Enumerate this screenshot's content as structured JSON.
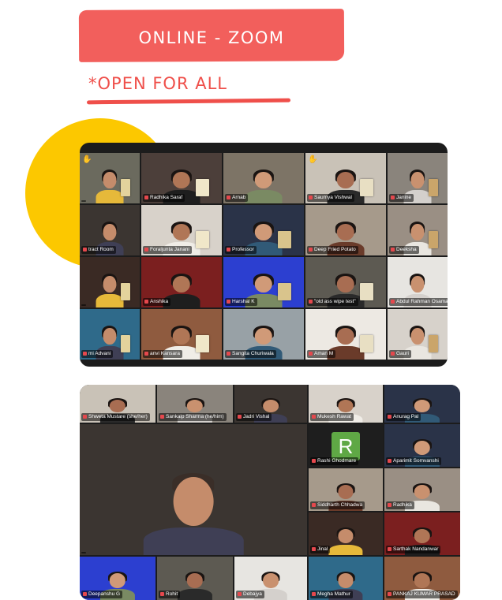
{
  "header": {
    "banner": "ONLINE - ZOOM",
    "subline": "*OPEN FOR ALL"
  },
  "colors": {
    "banner": "#f25f5c",
    "accent_text": "#ef4f4a",
    "blob": "#fcc800",
    "zoom_bg": "#1c1c1c",
    "active_speaker": "#c9e24a",
    "mute_icon": "#e5484d"
  },
  "screenshot_1": {
    "participants": [
      {
        "name": ""
      },
      {
        "name": "Radhika Saraf"
      },
      {
        "name": "Arnab"
      },
      {
        "name": "Saumya Vishwal"
      },
      {
        "name": "Janine"
      },
      {
        "name": "tract Room"
      },
      {
        "name": "Foraljunta Janani"
      },
      {
        "name": "Professor"
      },
      {
        "name": "Deep Fried Potato"
      },
      {
        "name": "Deeksha"
      },
      {
        "name": ""
      },
      {
        "name": "Anshika"
      },
      {
        "name": "Harshal K"
      },
      {
        "name": "\"old ass wipe test\""
      },
      {
        "name": "Abdul Rahman Osama"
      },
      {
        "name": "mi Advani"
      },
      {
        "name": "anvi Kansara"
      },
      {
        "name": "Sangita Churiwala"
      },
      {
        "name": "Aman M"
      },
      {
        "name": "Gauri"
      }
    ]
  },
  "screenshot_2": {
    "participants": [
      {
        "name": "Shweta Mustare (she/her)"
      },
      {
        "name": "Sankalp Sharma (he/him)"
      },
      {
        "name": "Jadri Vishal"
      },
      {
        "name": "Mukesh Rawat"
      },
      {
        "name": "Anurag Pal"
      },
      {
        "name": ""
      },
      {
        "name": "Rashi Ghodmare",
        "avatar_letter": "R"
      },
      {
        "name": "Aparimit Somvanshi"
      },
      {
        "name": "Siddharth Chhadwa"
      },
      {
        "name": "Radhika"
      },
      {
        "name": "Jinal"
      },
      {
        "name": "Sarthak Nandanwar"
      },
      {
        "name": "Deepanshu G"
      },
      {
        "name": "Rohit"
      },
      {
        "name": "Debajya"
      },
      {
        "name": "Megha Mathur"
      },
      {
        "name": "PANKAJ KUMAR PRASAD"
      }
    ]
  }
}
